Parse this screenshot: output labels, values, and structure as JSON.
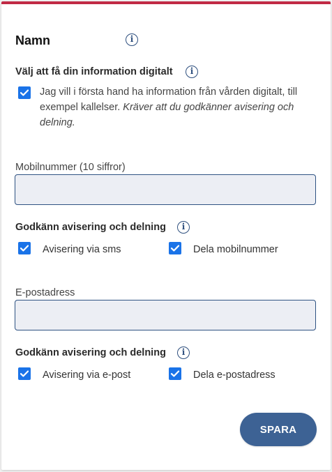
{
  "form": {
    "title": "Namn",
    "digital": {
      "heading": "Välj att få din information digitalt",
      "checkbox_text": "Jag vill i första hand ha information från vården digitalt, till exempel kallelser.",
      "checkbox_note": "Kräver att du godkänner avisering och delning.",
      "checked": true
    },
    "mobile": {
      "label": "Mobilnummer (10 siffror)",
      "value": "",
      "placeholder": ""
    },
    "sms_consent": {
      "heading": "Godkänn avisering och delning",
      "options": [
        {
          "label": "Avisering via sms",
          "checked": true
        },
        {
          "label": "Dela mobilnummer",
          "checked": true
        }
      ]
    },
    "email": {
      "label": "E-postadress",
      "value": "",
      "placeholder": ""
    },
    "email_consent": {
      "heading": "Godkänn avisering och delning",
      "options": [
        {
          "label": "Avisering via e-post",
          "checked": true
        },
        {
          "label": "Dela e-postadress",
          "checked": true
        }
      ]
    },
    "save_label": "SPARA"
  },
  "icons": {
    "info": "info-icon",
    "check": "checkmark-icon"
  },
  "colors": {
    "accent_top_border": "#c12a45",
    "checkbox": "#1a73e8",
    "info_icon": "#2e4f7e",
    "input_background": "#eceef4",
    "input_border": "#2e5282",
    "button": "#3d6294"
  }
}
